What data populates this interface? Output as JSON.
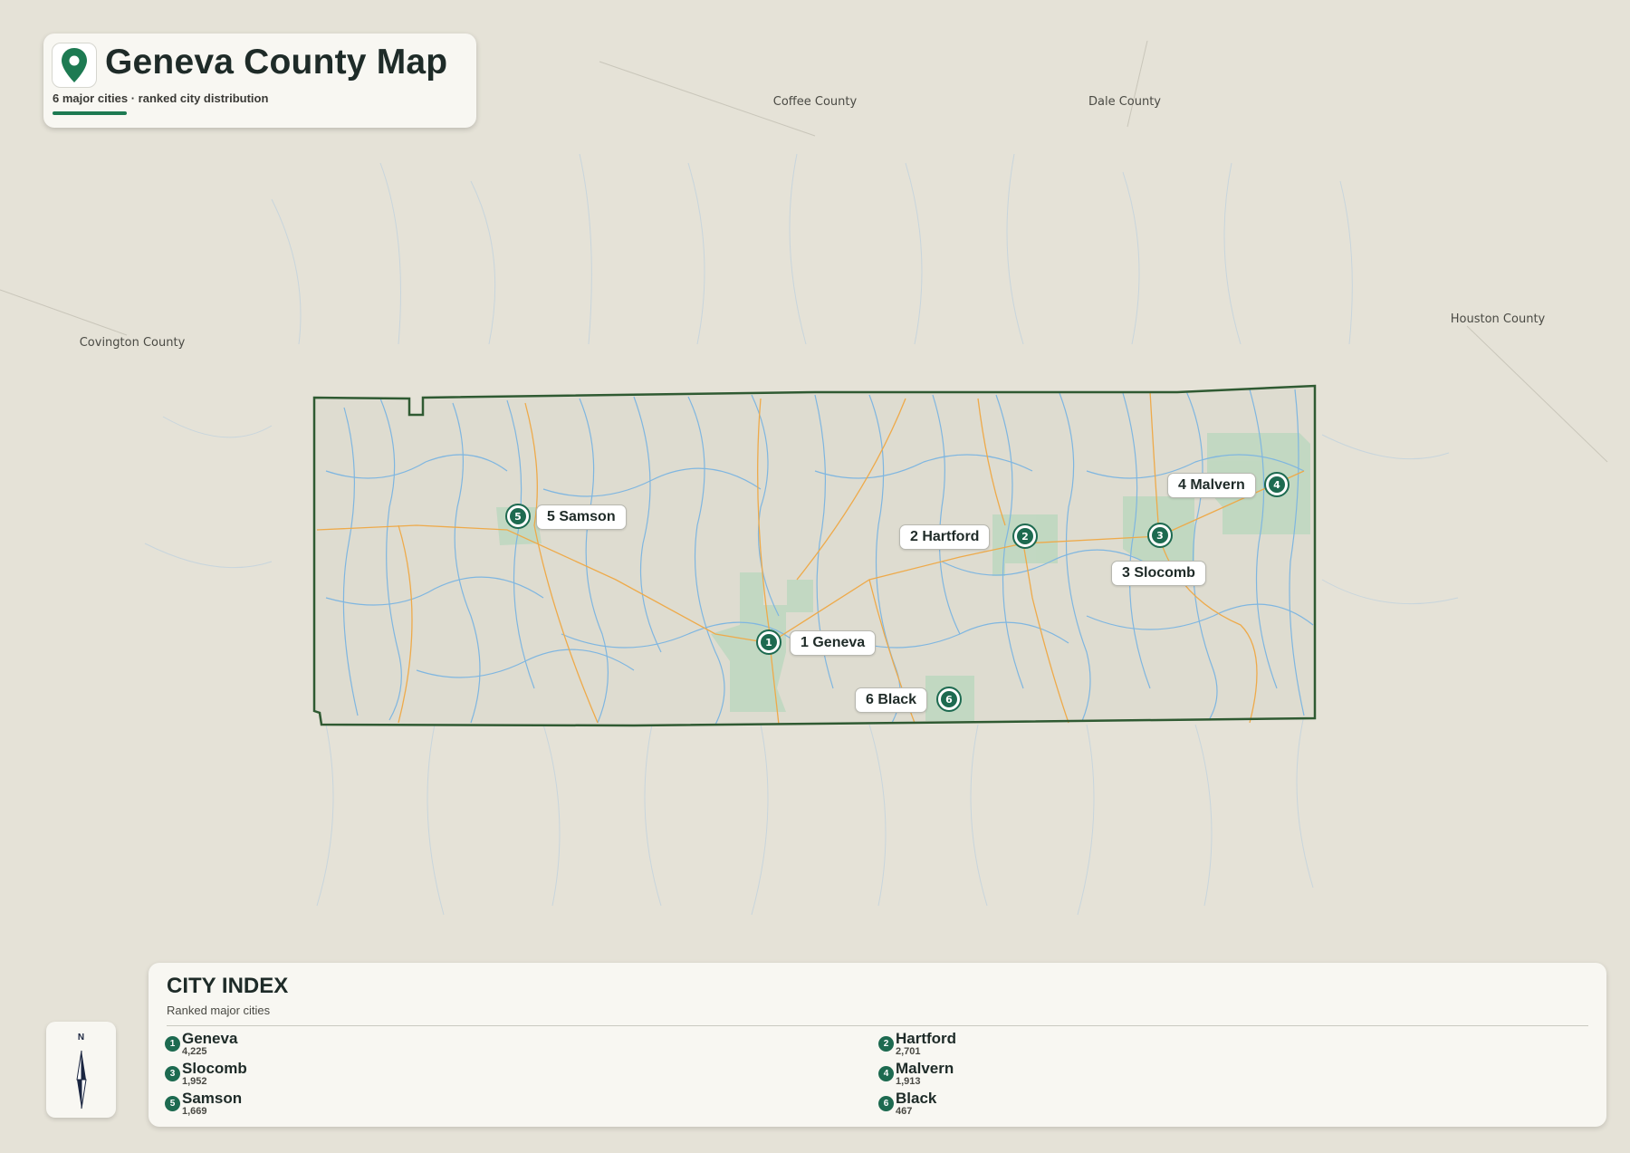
{
  "title": "Geneva County Map",
  "subtitle": "6 major cities · ranked city distribution",
  "neighbors": [
    {
      "name": "Coffee County"
    },
    {
      "name": "Dale County"
    },
    {
      "name": "Covington County"
    },
    {
      "name": "Houston County"
    }
  ],
  "cities": [
    {
      "rank": "1",
      "name": "Geneva",
      "label": "1 Geneva",
      "population": "4,225"
    },
    {
      "rank": "2",
      "name": "Hartford",
      "label": "2 Hartford",
      "population": "2,701"
    },
    {
      "rank": "3",
      "name": "Slocomb",
      "label": "3 Slocomb",
      "population": "1,952"
    },
    {
      "rank": "4",
      "name": "Malvern",
      "label": "4 Malvern",
      "population": "1,913"
    },
    {
      "rank": "5",
      "name": "Samson",
      "label": "5 Samson",
      "population": "1,669"
    },
    {
      "rank": "6",
      "name": "Black",
      "label": "6 Black",
      "population": "467"
    }
  ],
  "index": {
    "heading": "CITY INDEX",
    "subheading": "Ranked major cities"
  },
  "compass": {
    "north": "N"
  },
  "colors": {
    "background": "#e5e2d7",
    "county_border": "#2f5a32",
    "rivers": "#7fb6e0",
    "roads": "#eeaa4a",
    "urban": "#b8d7bd",
    "pin": "#1d6a50",
    "accent": "#1d7a52"
  }
}
